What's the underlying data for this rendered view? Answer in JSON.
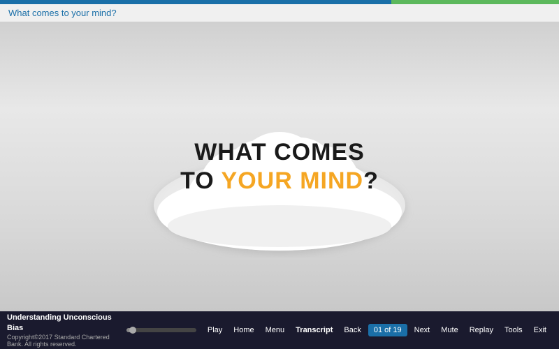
{
  "topbar": {
    "blue_pct": "70%",
    "green_pct": "30%"
  },
  "header": {
    "question": "What comes to your mind?"
  },
  "cloud": {
    "line1": "WHAT COMES",
    "line2_to": "TO ",
    "line2_yourmind": "YOUR MIND",
    "line2_q": "?"
  },
  "bottom": {
    "course_title": "Understanding Unconscious Bias",
    "copyright": "Copyright©2017  Standard Chartered Bank. All rights reserved.",
    "play_label": "Play",
    "home_label": "Home",
    "menu_label": "Menu",
    "transcript_label": "Transcript",
    "back_label": "Back",
    "page_current": "01",
    "page_total": "19",
    "next_label": "Next",
    "mute_label": "Mute",
    "replay_label": "Replay",
    "tools_label": "Tools",
    "exit_label": "Exit"
  }
}
